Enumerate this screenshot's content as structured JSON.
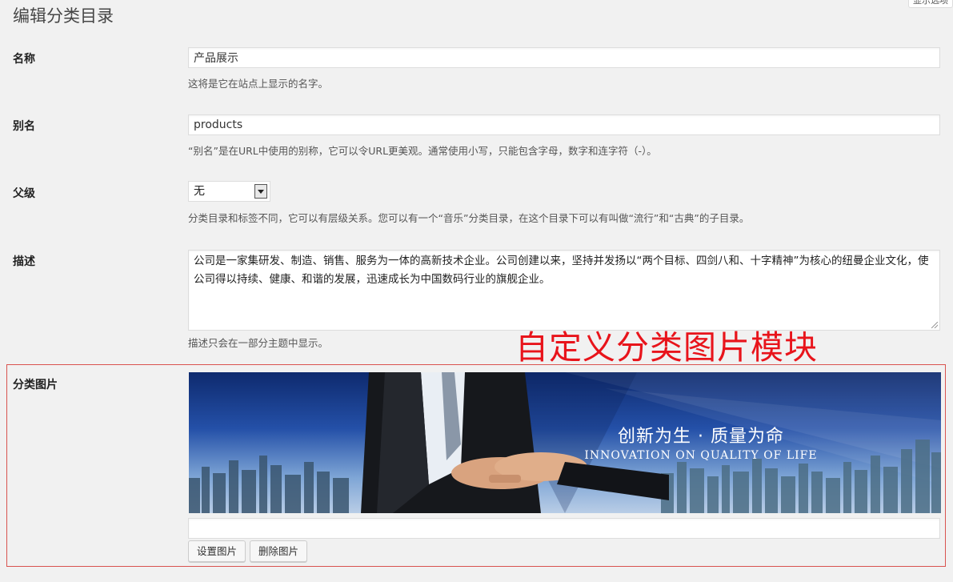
{
  "page": {
    "title": "编辑分类目录",
    "screen_options_label": "显示选项"
  },
  "fields": {
    "name": {
      "label": "名称",
      "value": "产品展示",
      "description": "这将是它在站点上显示的名字。"
    },
    "slug": {
      "label": "别名",
      "value": "products",
      "description": "“别名”是在URL中使用的别称，它可以令URL更美观。通常使用小写，只能包含字母，数字和连字符（-）。"
    },
    "parent": {
      "label": "父级",
      "selected": "无",
      "description": "分类目录和标签不同，它可以有层级关系。您可以有一个“音乐”分类目录，在这个目录下可以有叫做“流行”和“古典”的子目录。"
    },
    "description": {
      "label": "描述",
      "value": "公司是一家集研发、制造、销售、服务为一体的高新技术企业。公司创建以来，坚持并发扬以“两个目标、四剑八和、十字精神”为核心的纽曼企业文化，使公司得以持续、健康、和谐的发展，迅速成长为中国数码行业的旗舰企业。",
      "note": "描述只会在一部分主题中显示。"
    },
    "category_image": {
      "label": "分类图片",
      "banner_text_cn": "创新为生 · 质量为命",
      "banner_text_en": "INNOVATION ON QUALITY OF LIFE",
      "url_value": "",
      "set_button": "设置图片",
      "remove_button": "删除图片"
    }
  },
  "annotation": {
    "text": "自定义分类图片模块",
    "color": "#e8141b"
  }
}
